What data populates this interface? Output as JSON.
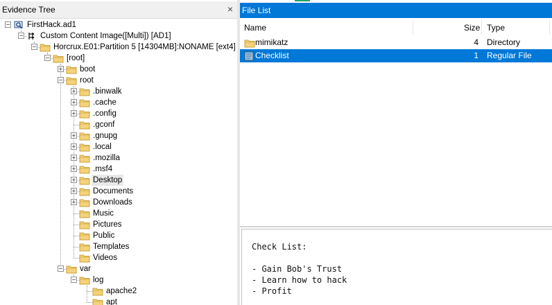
{
  "evidence_tree": {
    "title": "Evidence Tree",
    "close_label": "×",
    "nodes": [
      {
        "label": "FirstHack.ad1",
        "depth": 0,
        "type": "evidence",
        "expander": "minus"
      },
      {
        "label": "Custom Content Image([Multi]) [AD1]",
        "depth": 1,
        "type": "image",
        "expander": "minus"
      },
      {
        "label": "Horcrux.E01:Partition 5 [14304MB]:NONAME [ext4]",
        "depth": 2,
        "type": "folder",
        "expander": "minus"
      },
      {
        "label": "[root]",
        "depth": 3,
        "type": "folder",
        "expander": "minus"
      },
      {
        "label": "boot",
        "depth": 4,
        "type": "folder",
        "expander": "plus"
      },
      {
        "label": "root",
        "depth": 4,
        "type": "folder",
        "expander": "minus"
      },
      {
        "label": ".binwalk",
        "depth": 5,
        "type": "folder",
        "expander": "plus"
      },
      {
        "label": ".cache",
        "depth": 5,
        "type": "folder",
        "expander": "plus"
      },
      {
        "label": ".config",
        "depth": 5,
        "type": "folder",
        "expander": "plus"
      },
      {
        "label": ".gconf",
        "depth": 5,
        "type": "folder",
        "expander": "none"
      },
      {
        "label": ".gnupg",
        "depth": 5,
        "type": "folder",
        "expander": "plus"
      },
      {
        "label": ".local",
        "depth": 5,
        "type": "folder",
        "expander": "plus"
      },
      {
        "label": ".mozilla",
        "depth": 5,
        "type": "folder",
        "expander": "plus"
      },
      {
        "label": ".msf4",
        "depth": 5,
        "type": "folder",
        "expander": "plus"
      },
      {
        "label": "Desktop",
        "depth": 5,
        "type": "folder",
        "expander": "plus",
        "highlight": true
      },
      {
        "label": "Documents",
        "depth": 5,
        "type": "folder",
        "expander": "plus"
      },
      {
        "label": "Downloads",
        "depth": 5,
        "type": "folder",
        "expander": "plus"
      },
      {
        "label": "Music",
        "depth": 5,
        "type": "folder",
        "expander": "none"
      },
      {
        "label": "Pictures",
        "depth": 5,
        "type": "folder",
        "expander": "none"
      },
      {
        "label": "Public",
        "depth": 5,
        "type": "folder",
        "expander": "none"
      },
      {
        "label": "Templates",
        "depth": 5,
        "type": "folder",
        "expander": "none"
      },
      {
        "label": "Videos",
        "depth": 5,
        "type": "folder",
        "expander": "none"
      },
      {
        "label": "var",
        "depth": 4,
        "type": "folder",
        "expander": "minus"
      },
      {
        "label": "log",
        "depth": 5,
        "type": "folder",
        "expander": "minus"
      },
      {
        "label": "apache2",
        "depth": 6,
        "type": "folder",
        "expander": "none"
      },
      {
        "label": "apt",
        "depth": 6,
        "type": "folder",
        "expander": "none"
      }
    ]
  },
  "file_list": {
    "title": "File List",
    "columns": {
      "name": "Name",
      "size": "Size",
      "type": "Type"
    },
    "rows": [
      {
        "name": "mimikatz",
        "size": "4",
        "type": "Directory",
        "icon": "folder-icon",
        "selected": false
      },
      {
        "name": "Checklist",
        "size": "1",
        "type": "Regular File",
        "icon": "file-icon",
        "selected": true
      }
    ]
  },
  "preview": {
    "lines": [
      "Check List:",
      "",
      "- Gain Bob's Trust",
      "- Learn how to hack",
      "- Profit"
    ]
  },
  "colors": {
    "accent": "#0078d7",
    "folder": "#f5d27a",
    "folder_outline": "#c9a23c"
  }
}
